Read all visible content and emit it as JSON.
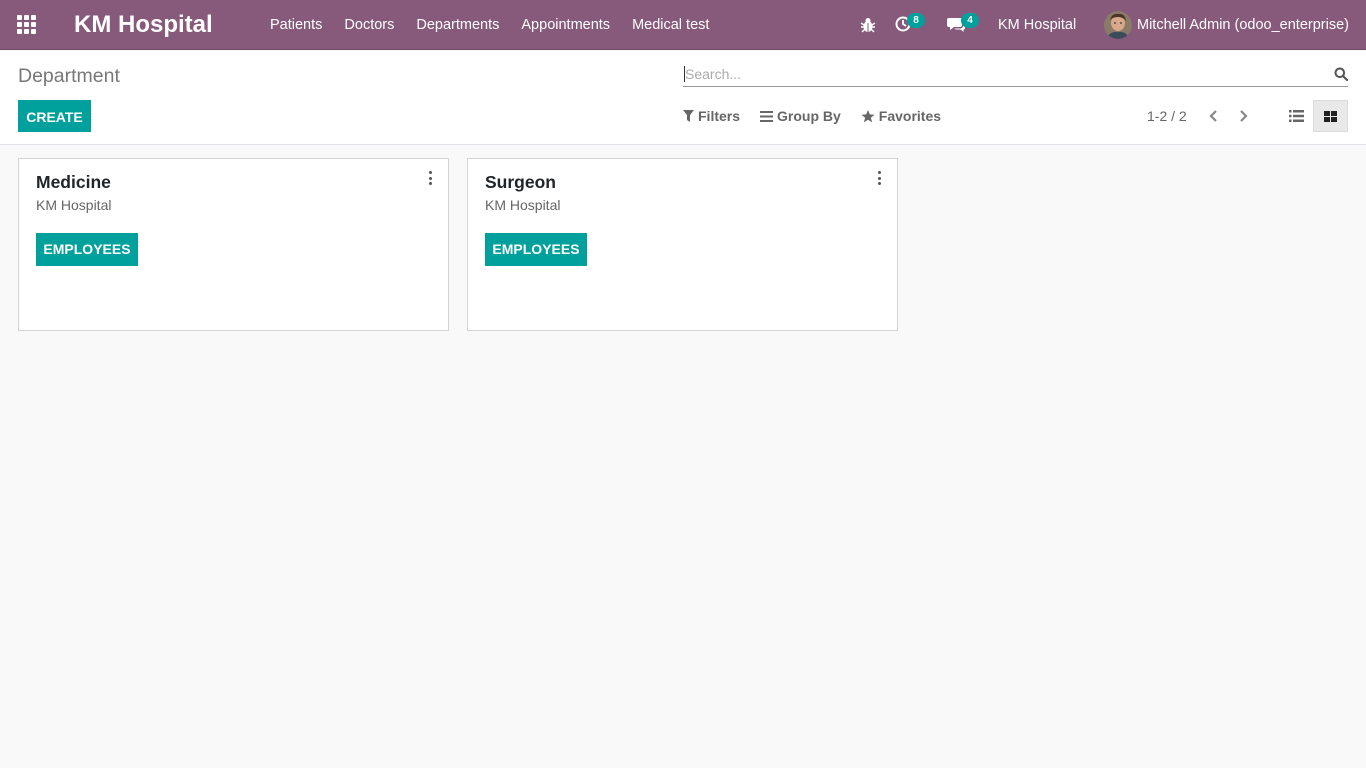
{
  "navbar": {
    "brand": "KM Hospital",
    "menu": [
      {
        "label": "Patients"
      },
      {
        "label": "Doctors"
      },
      {
        "label": "Departments"
      },
      {
        "label": "Appointments"
      },
      {
        "label": "Medical test"
      }
    ],
    "activity_count": "8",
    "message_count": "4",
    "company": "KM Hospital",
    "user": "Mitchell Admin (odoo_enterprise)",
    "bg_color": "#875a7b"
  },
  "control_panel": {
    "title": "Department",
    "create_label": "CREATE",
    "search_placeholder": "Search...",
    "filters_label": "Filters",
    "groupby_label": "Group By",
    "favorites_label": "Favorites",
    "pager": "1-2 / 2",
    "accent_color": "#00a09d"
  },
  "kanban": {
    "cards": [
      {
        "title": "Medicine",
        "company": "KM Hospital",
        "button": "EMPLOYEES"
      },
      {
        "title": "Surgeon",
        "company": "KM Hospital",
        "button": "EMPLOYEES"
      }
    ]
  },
  "icons": [
    "apps-grid-icon",
    "bug-icon",
    "clock-icon",
    "chat-icon",
    "search-icon",
    "filter-icon",
    "bars-icon",
    "star-icon",
    "chevron-left-icon",
    "chevron-right-icon",
    "list-view-icon",
    "kanban-view-icon",
    "vertical-dots-icon"
  ]
}
